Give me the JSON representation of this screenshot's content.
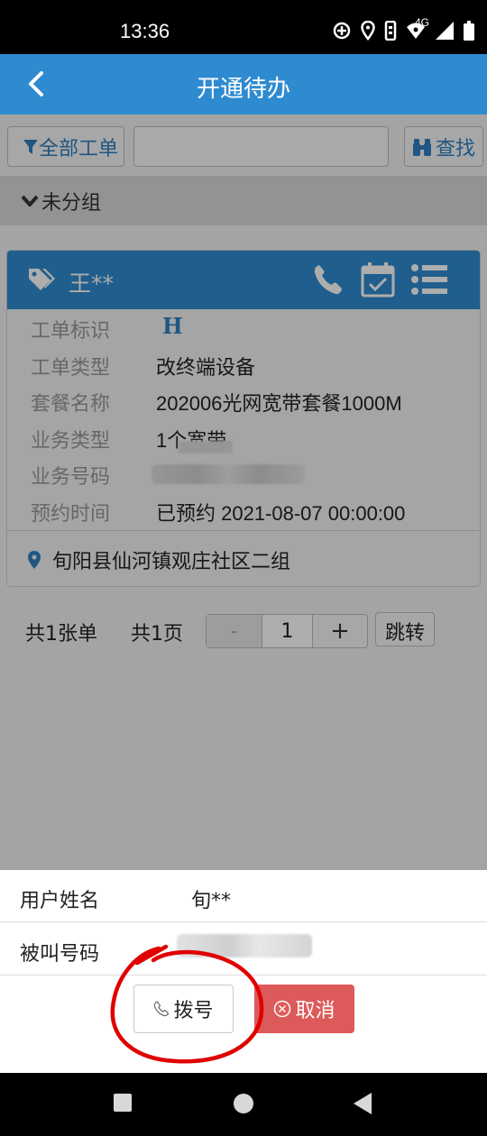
{
  "status_bar": {
    "time": "13:36",
    "network": "4G"
  },
  "app_bar": {
    "title": "开通待办"
  },
  "toolbar": {
    "filter_label": "全部工单",
    "search_placeholder": "",
    "find_label": "查找"
  },
  "group": {
    "label": "未分组"
  },
  "card": {
    "name": "王**",
    "rows": [
      {
        "label": "工单标识",
        "value": "H"
      },
      {
        "label": "工单类型",
        "value": "改终端设备"
      },
      {
        "label": "套餐名称",
        "value": "202006光网宽带套餐1000M"
      },
      {
        "label": "业务类型",
        "value": "1个宽带"
      },
      {
        "label": "业务号码",
        "value": ""
      },
      {
        "label": "预约时间",
        "value": "已预约 2021-08-07 00:00:00"
      }
    ],
    "address": "旬阳县仙河镇观庄社区二组"
  },
  "pager": {
    "total": "共1张单",
    "pages": "共1页",
    "minus": "-",
    "current": "1",
    "plus": "+",
    "jump": "跳转"
  },
  "dialog": {
    "rows": [
      {
        "label": "用户姓名",
        "value": "旬**"
      },
      {
        "label": "被叫号码",
        "value": ""
      }
    ],
    "dial_label": "拨号",
    "cancel_label": "取消"
  },
  "colors": {
    "primary": "#2f8bd0",
    "cancel": "#dd5a5a",
    "annotation": "#e00000"
  }
}
